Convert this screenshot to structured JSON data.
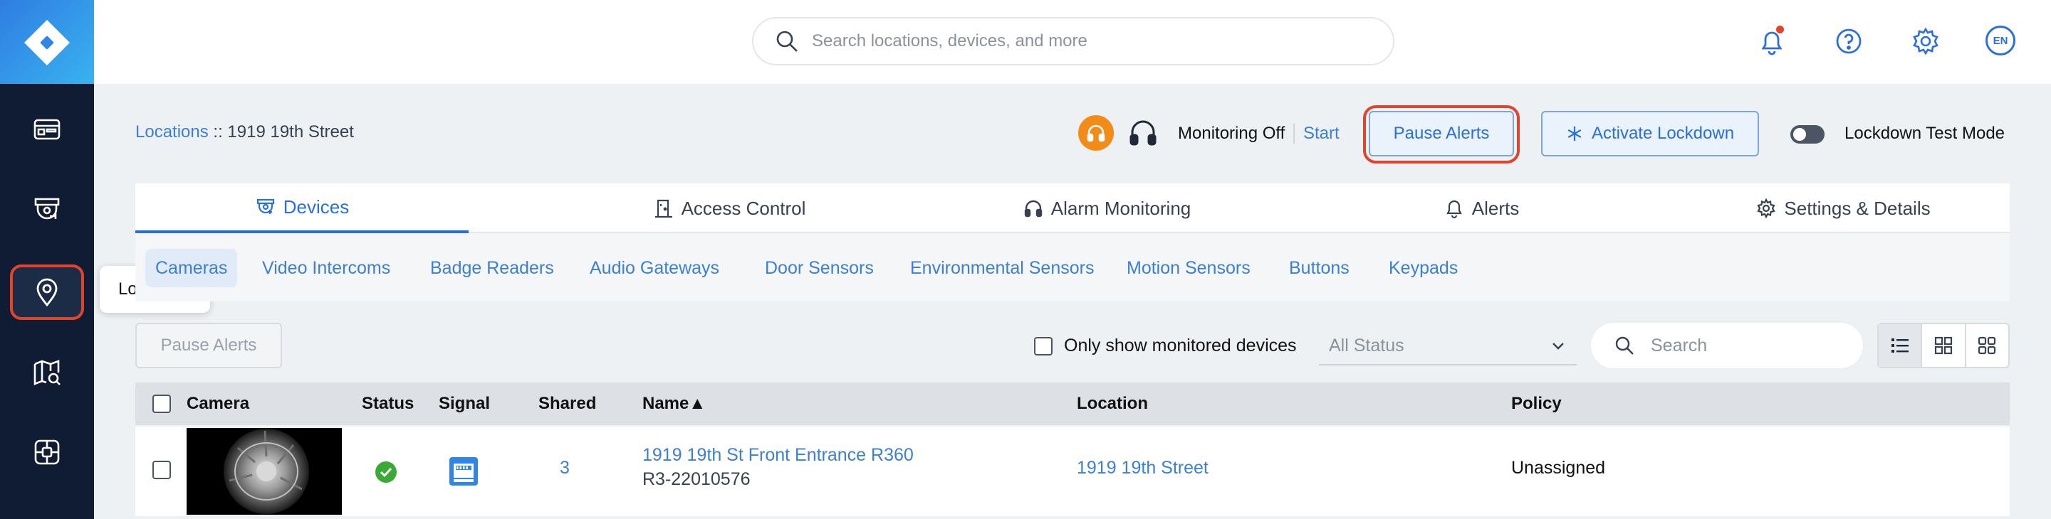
{
  "header": {
    "search_placeholder": "Search locations, devices, and more",
    "language": "EN"
  },
  "sidebar": {
    "tooltip": "Locations",
    "items": [
      "dashboard-icon",
      "cameras-icon",
      "location-pin-icon",
      "map-search-icon",
      "device-grid-icon"
    ]
  },
  "breadcrumb": {
    "link": "Locations",
    "separator": " :: ",
    "current": "1919 19th Street"
  },
  "monitoring": {
    "status": "Monitoring Off",
    "start_label": "Start"
  },
  "toolbar": {
    "pause_alerts": "Pause Alerts",
    "activate_lockdown": "Activate Lockdown",
    "lockdown_test_mode": "Lockdown Test Mode"
  },
  "tabs": [
    "Devices",
    "Access Control",
    "Alarm Monitoring",
    "Alerts",
    "Settings & Details"
  ],
  "subtabs": [
    "Cameras",
    "Video Intercoms",
    "Badge Readers",
    "Audio Gateways",
    "Door Sensors",
    "Environmental Sensors",
    "Motion Sensors",
    "Buttons",
    "Keypads"
  ],
  "filters": {
    "pause_alerts": "Pause Alerts",
    "only_monitored": "Only show monitored devices",
    "status_select": "All Status",
    "search_placeholder": "Search"
  },
  "table": {
    "columns": [
      "Camera",
      "Status",
      "Signal",
      "Shared",
      "Name▲",
      "Location",
      "Policy"
    ],
    "rows": [
      {
        "shared": "3",
        "name": "1919 19th St Front Entrance R360",
        "serial": "R3-22010576",
        "location": "1919 19th Street",
        "policy": "Unassigned"
      }
    ]
  },
  "colors": {
    "accent": "#2b6fdc",
    "highlight": "#e0442b",
    "sidebar": "#0f1c33",
    "status_ok": "#3aa935",
    "monitor_orange": "#f28b18"
  }
}
